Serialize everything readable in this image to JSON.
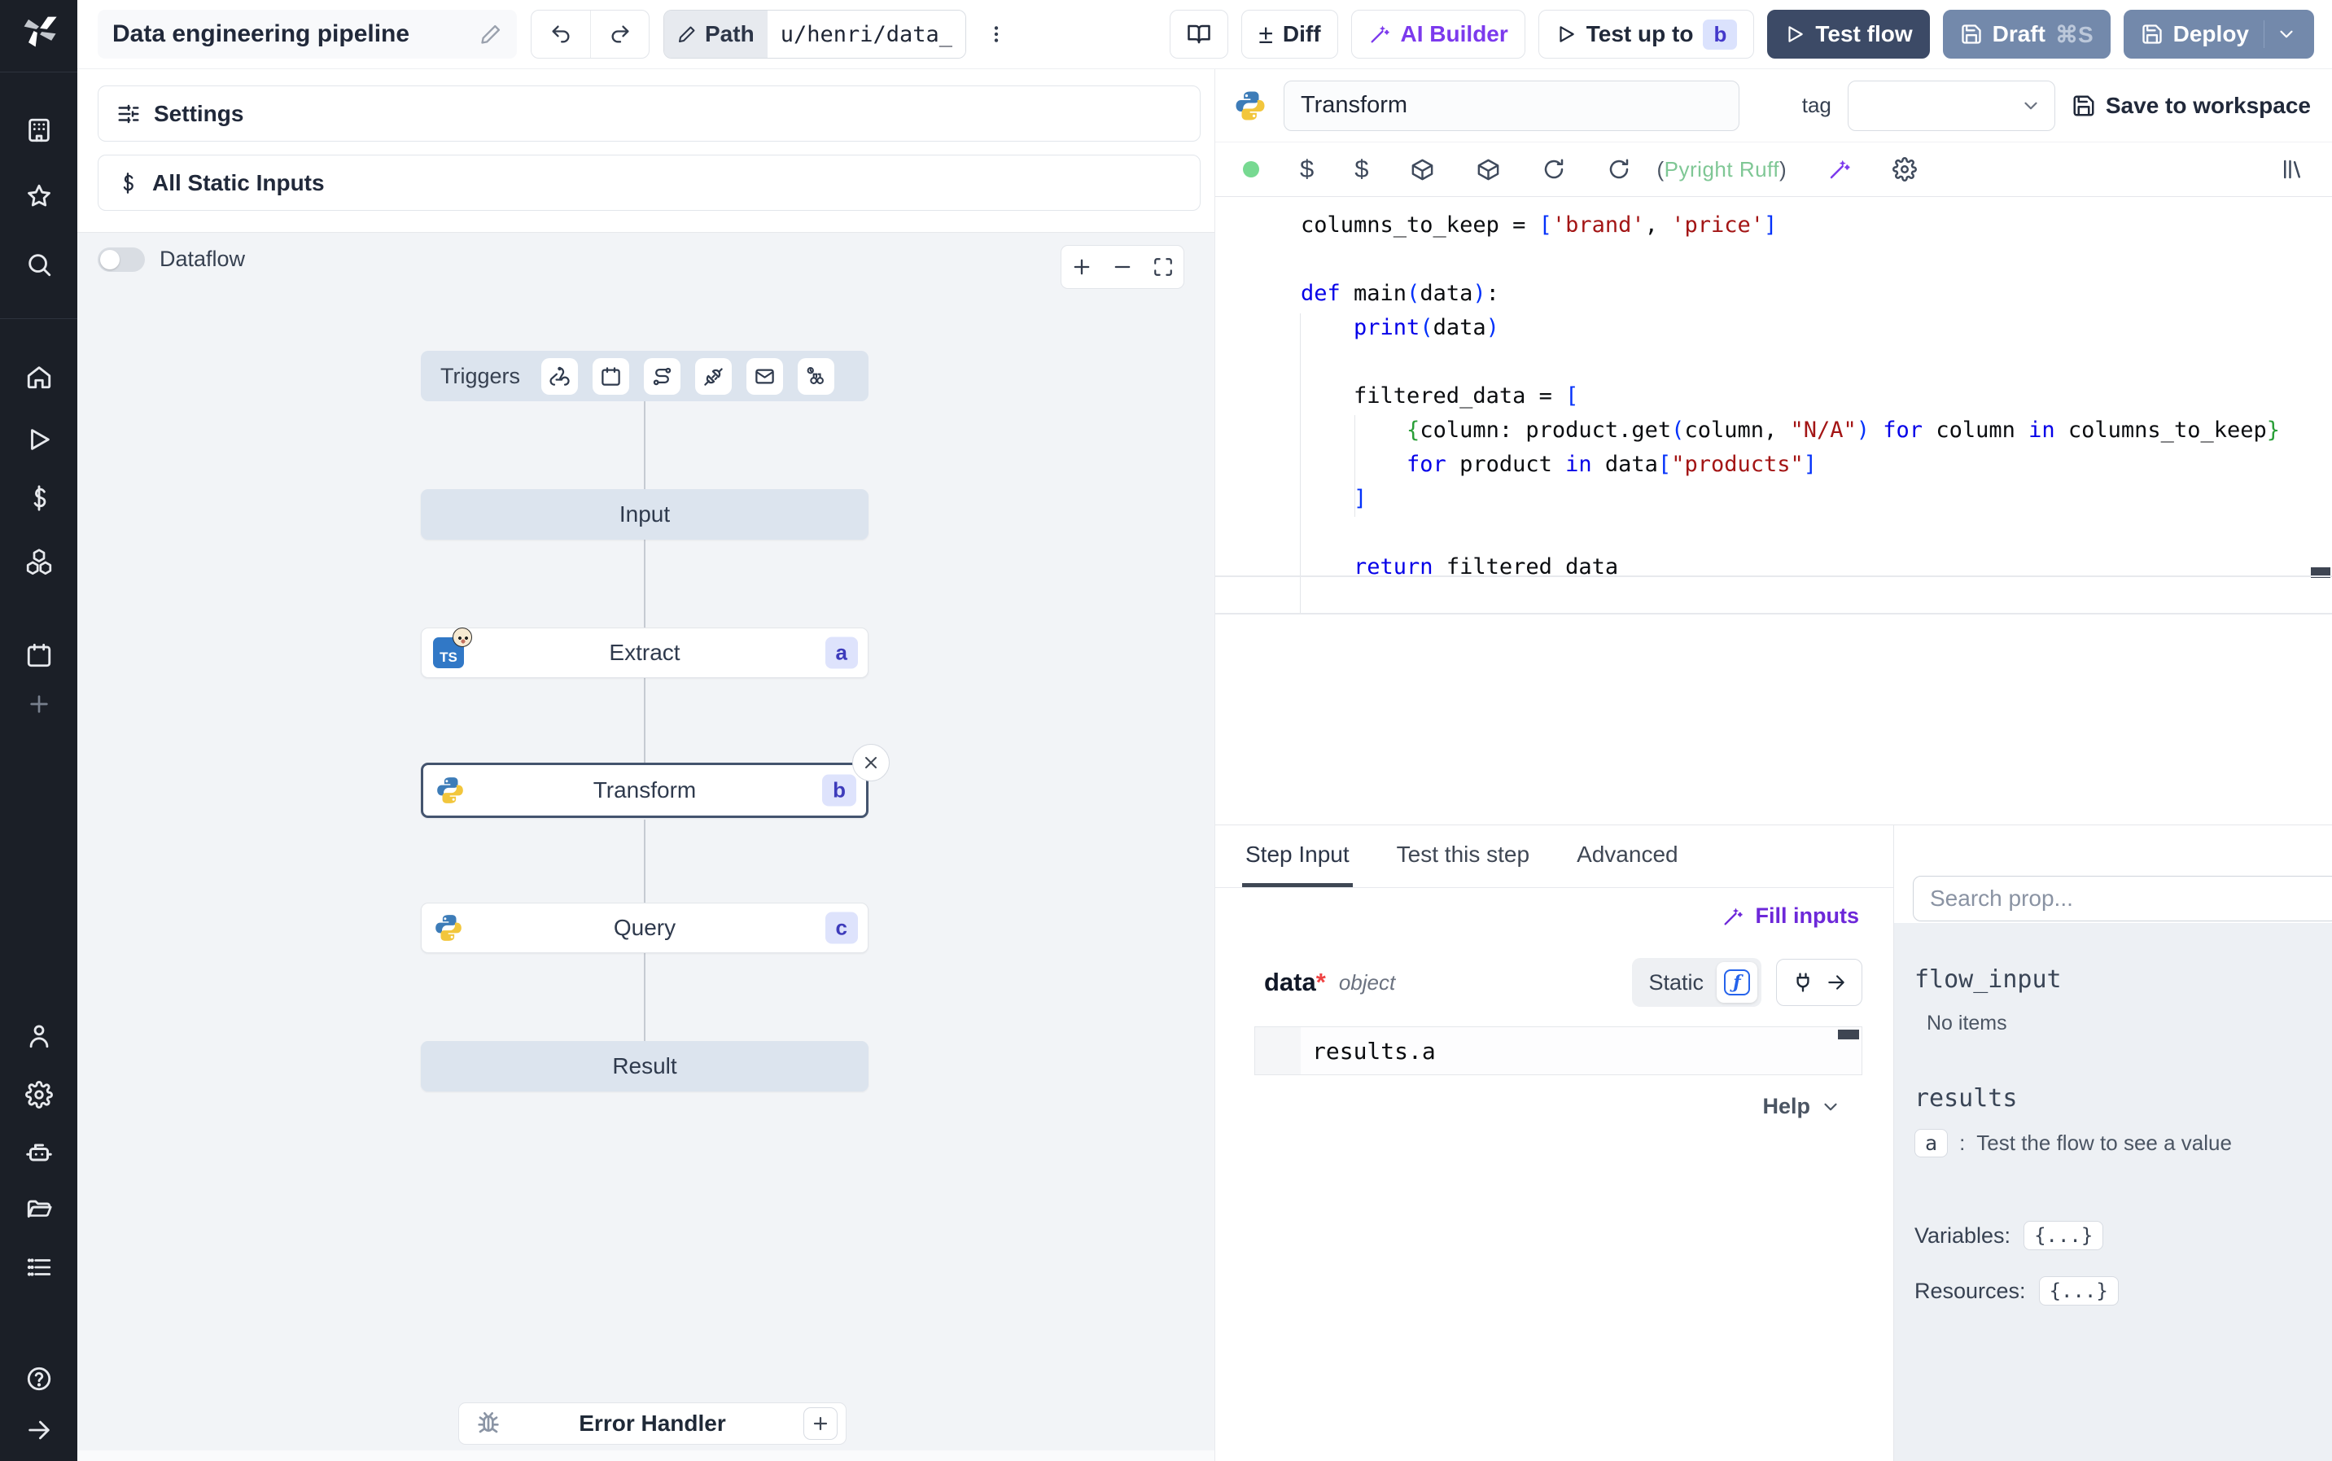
{
  "topbar": {
    "title": "Data engineering pipeline",
    "path_label": "Path",
    "path_value": "u/henri/data_",
    "diff_label": "Diff",
    "diff_sign": "±",
    "ai_builder_label": "AI Builder",
    "test_up_to_label": "Test up to",
    "test_up_to_badge": "b",
    "test_flow_label": "Test flow",
    "draft_label": "Draft",
    "draft_shortcut": "⌘S",
    "deploy_label": "Deploy"
  },
  "flow_panel": {
    "settings_label": "Settings",
    "static_inputs_label": "All Static Inputs",
    "dataflow_label": "Dataflow",
    "triggers_label": "Triggers",
    "nodes": {
      "input_label": "Input",
      "extract": {
        "label": "Extract",
        "badge": "a",
        "lang": "TS"
      },
      "transform": {
        "label": "Transform",
        "badge": "b"
      },
      "query": {
        "label": "Query",
        "badge": "c"
      },
      "result_label": "Result"
    },
    "error_handler_label": "Error Handler"
  },
  "editor": {
    "step_name": "Transform",
    "tag_label": "tag",
    "save_label": "Save to workspace",
    "lint_open": "(",
    "lint_text": "Pyright Ruff",
    "lint_close": ")",
    "code_lines": [
      [
        [
          "p",
          "columns_to_keep = "
        ],
        [
          "b",
          "["
        ],
        [
          "s",
          "'brand'"
        ],
        [
          "p",
          ", "
        ],
        [
          "s",
          "'price'"
        ],
        [
          "b",
          "]"
        ]
      ],
      [],
      [
        [
          "k",
          "def "
        ],
        [
          "p",
          "main"
        ],
        [
          "b",
          "("
        ],
        [
          "p",
          "data"
        ],
        [
          "b",
          ")"
        ],
        [
          "p",
          ":"
        ]
      ],
      [
        [
          "p",
          "    "
        ],
        [
          "k",
          "print"
        ],
        [
          "b",
          "("
        ],
        [
          "p",
          "data"
        ],
        [
          "b",
          ")"
        ]
      ],
      [],
      [
        [
          "p",
          "    filtered_data = "
        ],
        [
          "b",
          "["
        ]
      ],
      [
        [
          "p",
          "        "
        ],
        [
          "g",
          "{"
        ],
        [
          "p",
          "column: product.get"
        ],
        [
          "b",
          "("
        ],
        [
          "p",
          "column, "
        ],
        [
          "s",
          "\"N/A\""
        ],
        [
          "b",
          ")"
        ],
        [
          "p",
          " "
        ],
        [
          "k",
          "for"
        ],
        [
          "p",
          " column "
        ],
        [
          "k",
          "in"
        ],
        [
          "p",
          " columns_to_keep"
        ],
        [
          "g",
          "}"
        ]
      ],
      [
        [
          "p",
          "        "
        ],
        [
          "k",
          "for"
        ],
        [
          "p",
          " product "
        ],
        [
          "k",
          "in"
        ],
        [
          "p",
          " data"
        ],
        [
          "b",
          "["
        ],
        [
          "s",
          "\"products\""
        ],
        [
          "b",
          "]"
        ]
      ],
      [
        [
          "p",
          "    "
        ],
        [
          "b",
          "]"
        ]
      ],
      [],
      [
        [
          "p",
          "    "
        ],
        [
          "k",
          "return"
        ],
        [
          "p",
          " filtered_data"
        ]
      ]
    ]
  },
  "bottom": {
    "tabs": [
      "Step Input",
      "Test this step",
      "Advanced"
    ],
    "active_tab": "Step Input",
    "fill_inputs_label": "Fill inputs",
    "arg_name": "data",
    "arg_required": "*",
    "arg_type": "object",
    "static_label": "Static",
    "expr_value": "results.a",
    "help_label": "Help"
  },
  "props": {
    "search_placeholder": "Search prop...",
    "flow_input_label": "flow_input",
    "no_items": "No items",
    "results_label": "results",
    "result_key": "a",
    "result_sep": ":",
    "result_hint": "Test the flow to see a value",
    "variables_label": "Variables:",
    "variables_value": "{...}",
    "resources_label": "Resources:",
    "resources_value": "{...}"
  }
}
